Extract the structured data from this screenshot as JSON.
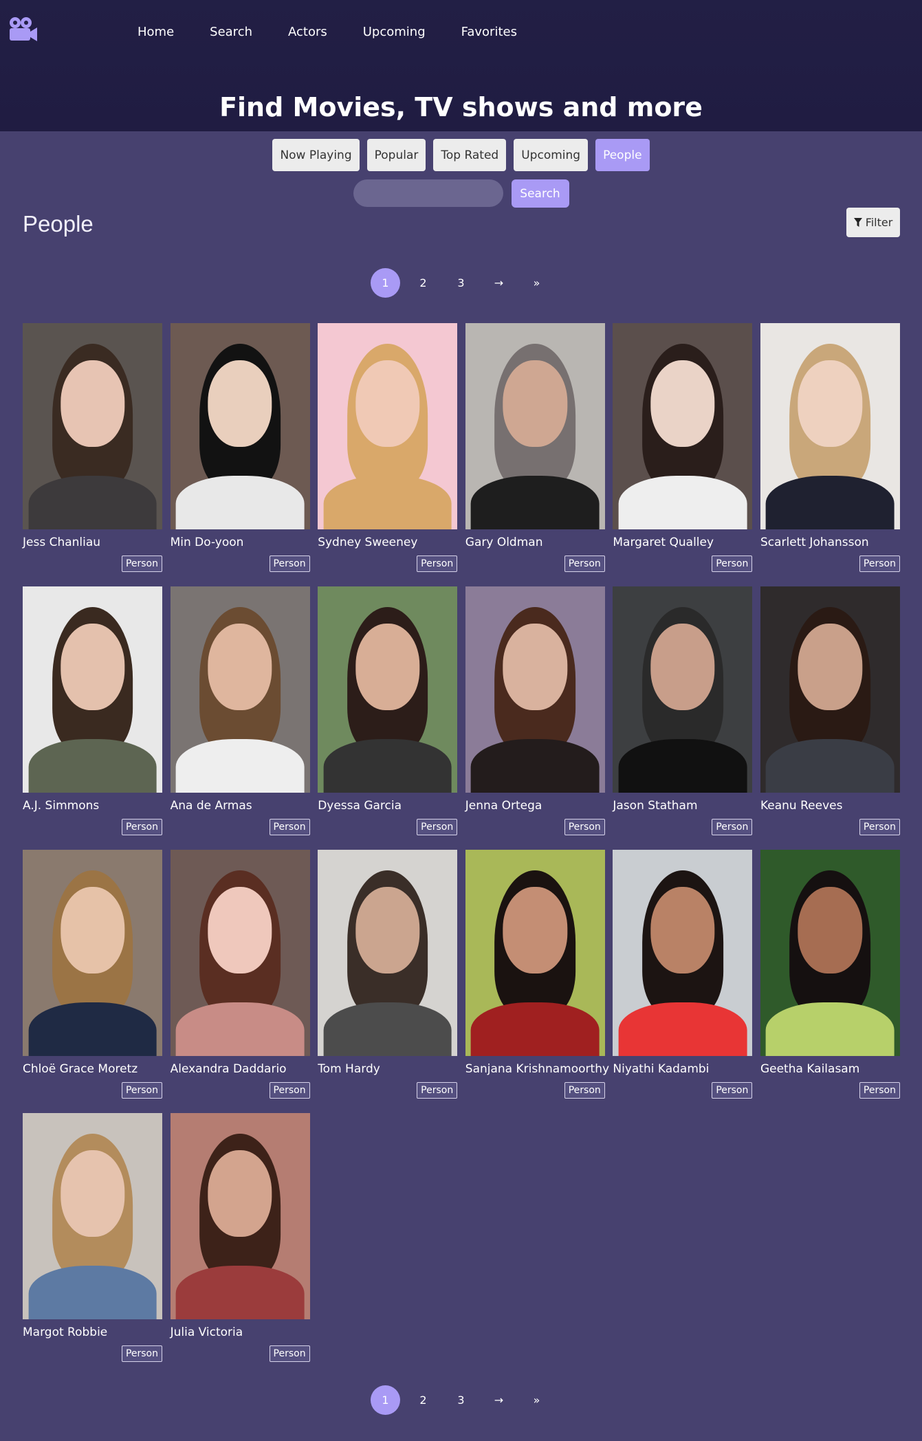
{
  "nav": {
    "items": [
      "Home",
      "Search",
      "Actors",
      "Upcoming",
      "Favorites"
    ]
  },
  "hero": {
    "title": "Find Movies, TV shows and more"
  },
  "categories": [
    "Now Playing",
    "Popular",
    "Top Rated",
    "Upcoming",
    "People"
  ],
  "active_category": "People",
  "search": {
    "value": "",
    "placeholder": "",
    "button_label": "Search"
  },
  "section": {
    "title": "People",
    "filter_label": "Filter"
  },
  "pagination": {
    "pages": [
      "1",
      "2",
      "3",
      "→",
      "»"
    ],
    "active": "1"
  },
  "people": [
    {
      "name": "Jess Chanliau",
      "type": "Person",
      "bg": "#5a5450",
      "hair": "#3a2b22",
      "skin": "#e7c4b3",
      "shirt": "#3d3a3c"
    },
    {
      "name": "Min Do-yoon",
      "type": "Person",
      "bg": "#6d5a52",
      "hair": "#121212",
      "skin": "#e9cfbd",
      "shirt": "#e8e8e8"
    },
    {
      "name": "Sydney Sweeney",
      "type": "Person",
      "bg": "#f4c8d2",
      "hair": "#d9a86a",
      "skin": "#f0c9b5",
      "shirt": "#d9a86a"
    },
    {
      "name": "Gary Oldman",
      "type": "Person",
      "bg": "#b9b6b2",
      "hair": "#777070",
      "skin": "#cfa792",
      "shirt": "#1e1e1e"
    },
    {
      "name": "Margaret Qualley",
      "type": "Person",
      "bg": "#5b4f4c",
      "hair": "#2a1e1b",
      "skin": "#ead3c7",
      "shirt": "#eeeeee"
    },
    {
      "name": "Scarlett Johansson",
      "type": "Person",
      "bg": "#e9e6e3",
      "hair": "#c9a77a",
      "skin": "#eed1bf",
      "shirt": "#1f2130"
    },
    {
      "name": "A.J. Simmons",
      "type": "Person",
      "bg": "#e8e8e8",
      "hair": "#3a2a20",
      "skin": "#e4c1ad",
      "shirt": "#5d6552"
    },
    {
      "name": "Ana de Armas",
      "type": "Person",
      "bg": "#7a7472",
      "hair": "#6b4c32",
      "skin": "#dfb69e",
      "shirt": "#eeeeee"
    },
    {
      "name": "Dyessa Garcia",
      "type": "Person",
      "bg": "#6f8a5e",
      "hair": "#2c1d19",
      "skin": "#d8ae96",
      "shirt": "#333333"
    },
    {
      "name": "Jenna Ortega",
      "type": "Person",
      "bg": "#8b7c98",
      "hair": "#4a2a1e",
      "skin": "#d9b29e",
      "shirt": "#231c1c"
    },
    {
      "name": "Jason Statham",
      "type": "Person",
      "bg": "#3d3f41",
      "hair": "#2a2a2a",
      "skin": "#c89e8a",
      "shirt": "#111111"
    },
    {
      "name": "Keanu Reeves",
      "type": "Person",
      "bg": "#2f2b2c",
      "hair": "#2a1a14",
      "skin": "#c9a08a",
      "shirt": "#3a3d45"
    },
    {
      "name": "Chloë Grace Moretz",
      "type": "Person",
      "bg": "#8a7a6e",
      "hair": "#9b7445",
      "skin": "#e6c2a8",
      "shirt": "#1f2a44"
    },
    {
      "name": "Alexandra Daddario",
      "type": "Person",
      "bg": "#6e5a55",
      "hair": "#5a2e22",
      "skin": "#efc8bc",
      "shirt": "#c88c86"
    },
    {
      "name": "Tom Hardy",
      "type": "Person",
      "bg": "#d5d3d0",
      "hair": "#3a2e28",
      "skin": "#cba58f",
      "shirt": "#4c4c4c"
    },
    {
      "name": "Sanjana Krishnamoorthy",
      "type": "Person",
      "bg": "#a9b858",
      "hair": "#1a1210",
      "skin": "#c48e74",
      "shirt": "#a02020"
    },
    {
      "name": "Niyathi Kadambi",
      "type": "Person",
      "bg": "#c9cdd1",
      "hair": "#1c1412",
      "skin": "#b98266",
      "shirt": "#e83535"
    },
    {
      "name": "Geetha Kailasam",
      "type": "Person",
      "bg": "#2f5a2a",
      "hair": "#151010",
      "skin": "#a66d52",
      "shirt": "#b7d06a"
    },
    {
      "name": "Margot Robbie",
      "type": "Person",
      "bg": "#c8c2bc",
      "hair": "#b38c5c",
      "skin": "#e6c3ae",
      "shirt": "#5d7aa3"
    },
    {
      "name": "Julia Victoria",
      "type": "Person",
      "bg": "#b57d72",
      "hair": "#3d2219",
      "skin": "#d3a48e",
      "shirt": "#9b3c3c"
    }
  ]
}
